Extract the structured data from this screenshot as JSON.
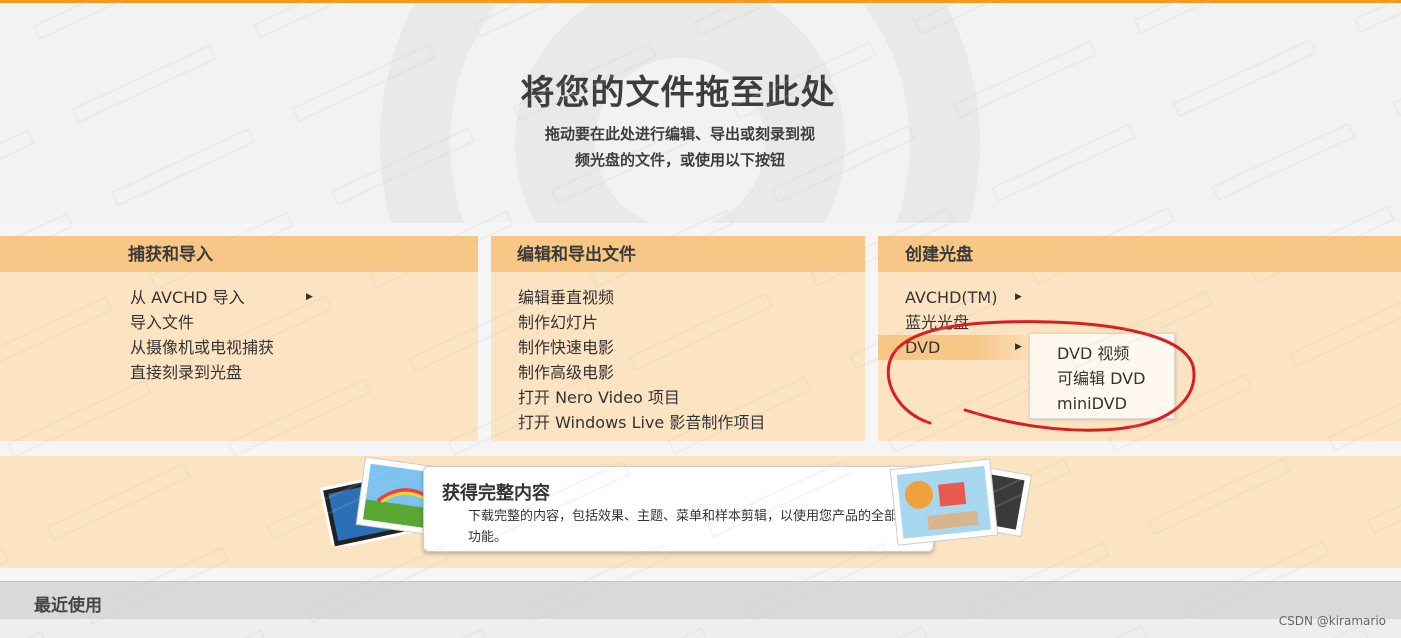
{
  "drop_zone": {
    "title": "将您的文件拖至此处",
    "subtitle_line1": "拖动要在此处进行编辑、导出或刻录到视",
    "subtitle_line2": "频光盘的文件，或使用以下按钮"
  },
  "panels": [
    {
      "title": "捕获和导入",
      "items": [
        "从 AVCHD 导入",
        "导入文件",
        "从摄像机或电视捕获",
        "直接刻录到光盘"
      ]
    },
    {
      "title": "编辑和导出文件",
      "items": [
        "编辑垂直视频",
        "制作幻灯片",
        "制作快速电影",
        "制作高级电影",
        "打开 Nero Video 项目",
        "打开 Windows Live 影音制作项目"
      ]
    },
    {
      "title": "创建光盘",
      "items": [
        "AVCHD(TM)",
        "蓝光光盘",
        "DVD"
      ]
    }
  ],
  "dvd_submenu": {
    "items": [
      "DVD 视频",
      "可编辑 DVD",
      "miniDVD"
    ]
  },
  "promo": {
    "title": "获得完整内容",
    "text": "下载完整的内容，包括效果、主题、菜单和样本剪辑，以使用您产品的全部功能。"
  },
  "recent": {
    "label": "最近使用"
  },
  "credit": "CSDN @kiramario",
  "colors": {
    "accent": "#f39a1e",
    "panel_bg": "#fce3c1",
    "panel_header": "#f8c685",
    "annotation": "#d81e1e"
  }
}
